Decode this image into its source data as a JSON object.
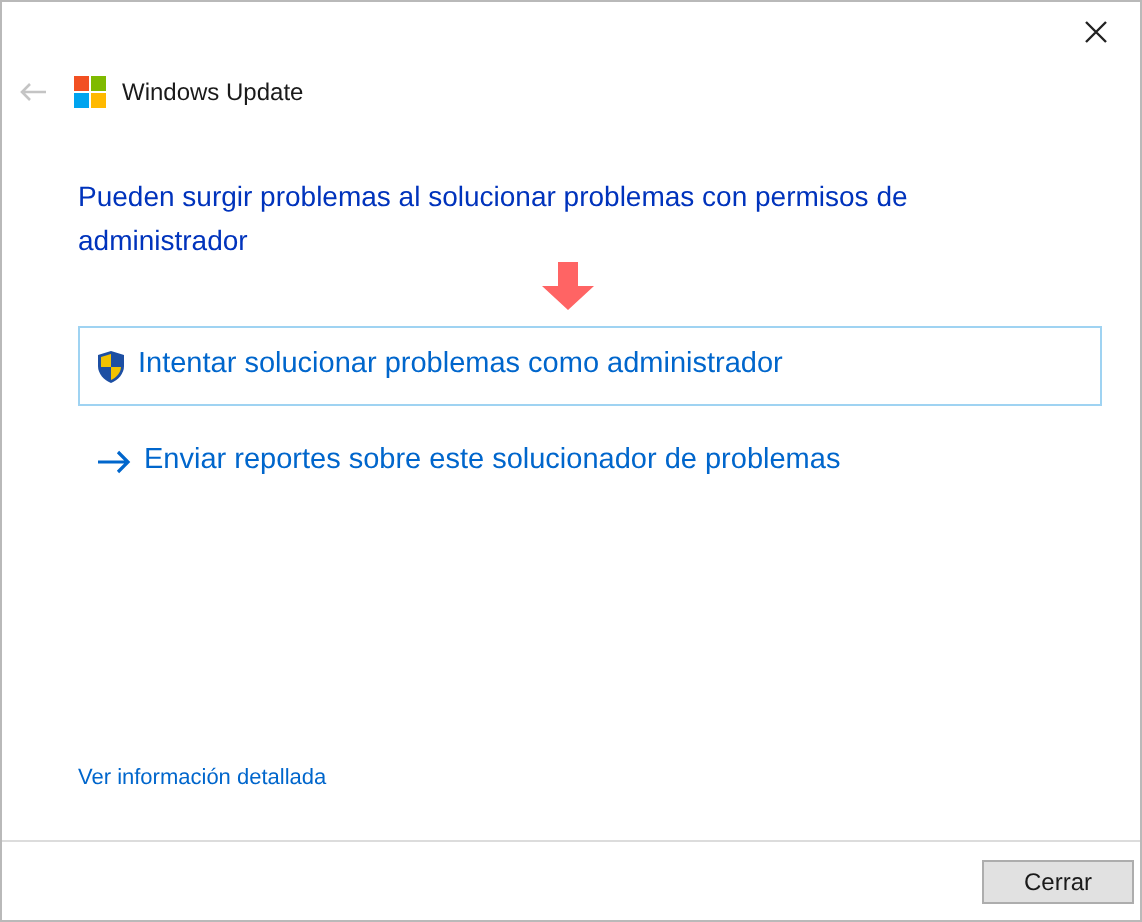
{
  "window": {
    "title": "Windows Update",
    "back_disabled": true
  },
  "heading": "Pueden surgir problemas al solucionar problemas con permisos de administrador",
  "options": [
    {
      "kind": "admin",
      "label": "Intentar solucionar problemas como administrador",
      "highlighted": true
    },
    {
      "kind": "link",
      "label": "Enviar reportes sobre este solucionador de problemas",
      "highlighted": false
    }
  ],
  "details_link": "Ver información detallada",
  "buttons": [
    "Cerrar"
  ]
}
